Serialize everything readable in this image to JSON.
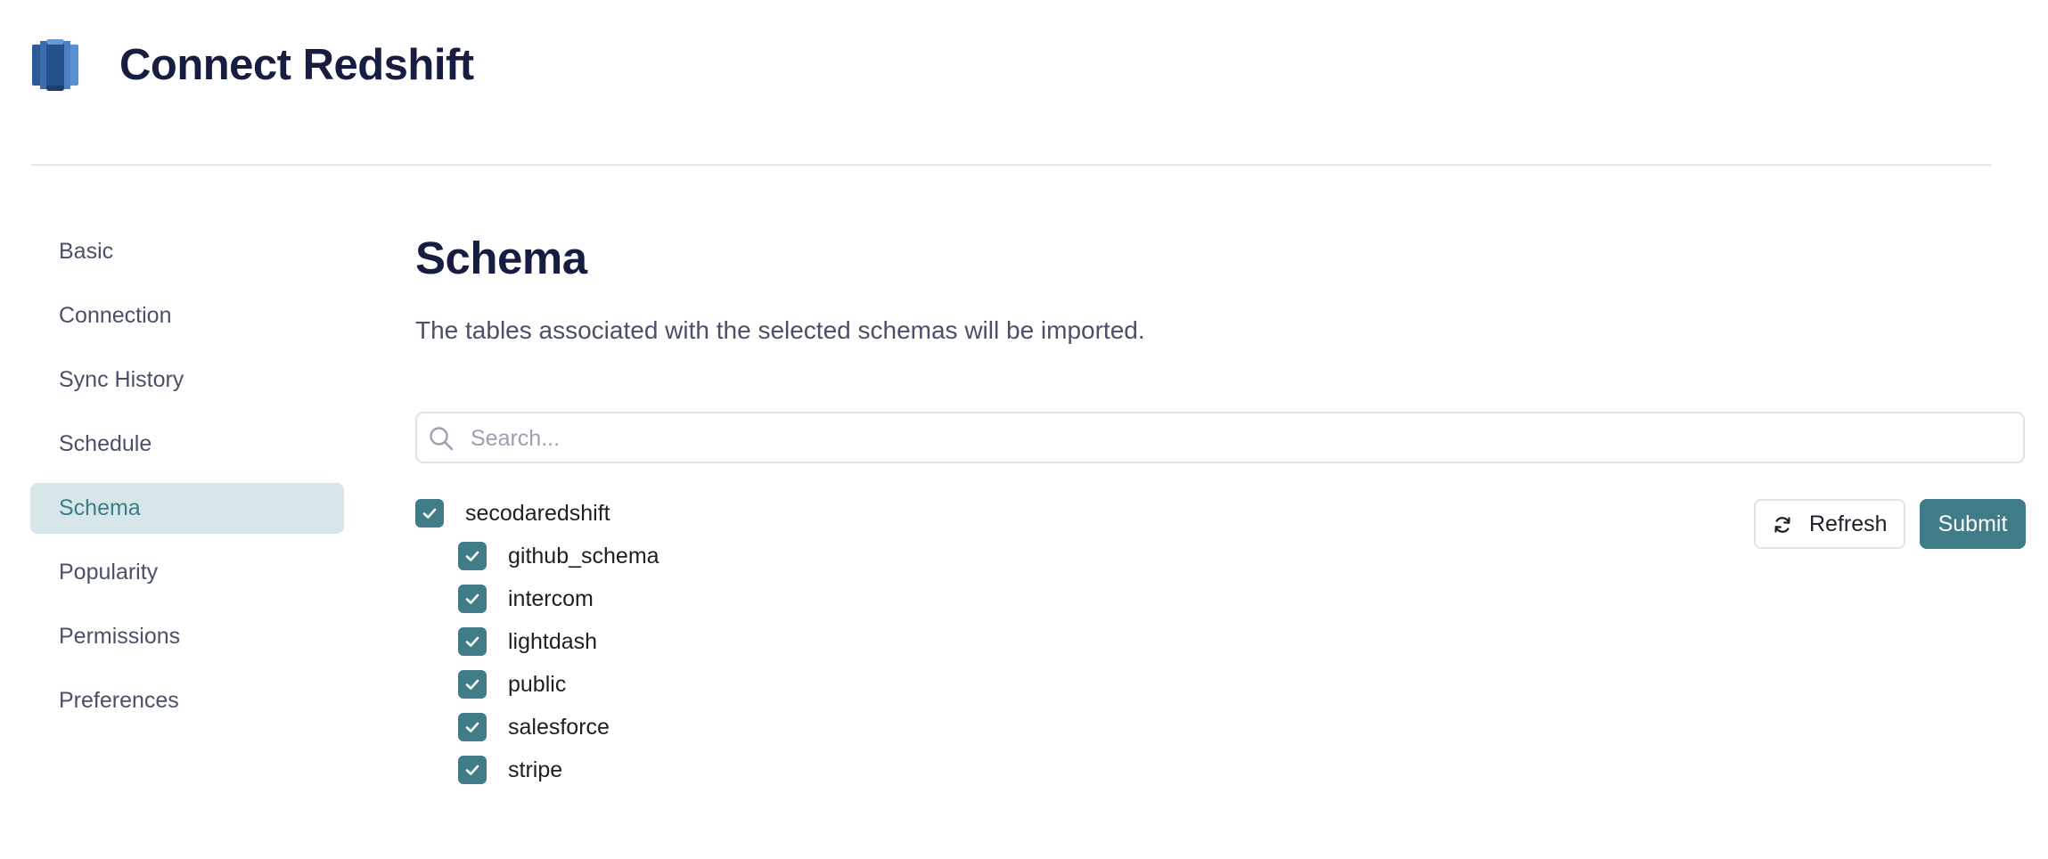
{
  "header": {
    "title": "Connect Redshift",
    "logo_icon": "redshift-logo"
  },
  "sidebar": {
    "items": [
      {
        "label": "Basic",
        "active": false
      },
      {
        "label": "Connection",
        "active": false
      },
      {
        "label": "Sync History",
        "active": false
      },
      {
        "label": "Schedule",
        "active": false
      },
      {
        "label": "Schema",
        "active": true
      },
      {
        "label": "Popularity",
        "active": false
      },
      {
        "label": "Permissions",
        "active": false
      },
      {
        "label": "Preferences",
        "active": false
      }
    ]
  },
  "main": {
    "title": "Schema",
    "description": "The tables associated with the selected schemas will be imported.",
    "search": {
      "placeholder": "Search...",
      "value": "",
      "icon": "search-icon"
    },
    "tree": {
      "root": {
        "label": "secodaredshift",
        "checked": true
      },
      "children": [
        {
          "label": "github_schema",
          "checked": true
        },
        {
          "label": "intercom",
          "checked": true
        },
        {
          "label": "lightdash",
          "checked": true
        },
        {
          "label": "public",
          "checked": true
        },
        {
          "label": "salesforce",
          "checked": true
        },
        {
          "label": "stripe",
          "checked": true
        }
      ]
    },
    "actions": {
      "refresh_label": "Refresh",
      "refresh_icon": "refresh-icon",
      "submit_label": "Submit"
    }
  },
  "colors": {
    "accent": "#3f7c88",
    "active_bg": "#d7e6e8",
    "active_text": "#3d7d89",
    "title_text": "#161d40",
    "muted_text": "#4a5068"
  }
}
